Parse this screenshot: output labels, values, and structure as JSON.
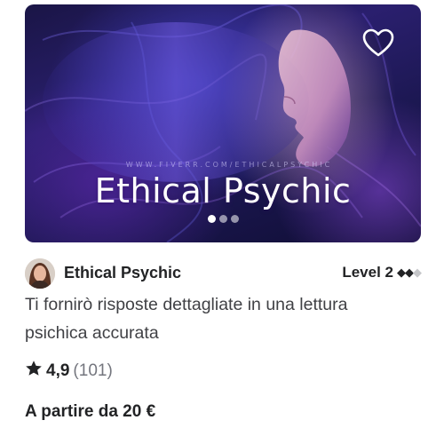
{
  "gig_card": {
    "thumbnail": {
      "watermark_text": "WWW.FIVERR.COM/ETHICALPSYCHIC",
      "overlay_title": "Ethical Psychic",
      "favorite_icon": "heart-outline-icon",
      "carousel_dots": 3,
      "active_dot": 1
    },
    "seller": {
      "name": "Ethical Psychic",
      "level_label": "Level 2",
      "level_filled": "◆◆",
      "level_empty": "◆"
    },
    "title": "Ti fornirò risposte dettagliate in una lettura psichica accurata",
    "rating": {
      "icon": "star-icon",
      "score": "4,9",
      "count": "(101)"
    },
    "price_text": "A partire da 20 €"
  },
  "colors": {
    "text_primary": "#222325",
    "text_secondary": "#404145",
    "text_muted": "#74767e",
    "thumbnail_bg": "#1f1a5c"
  }
}
